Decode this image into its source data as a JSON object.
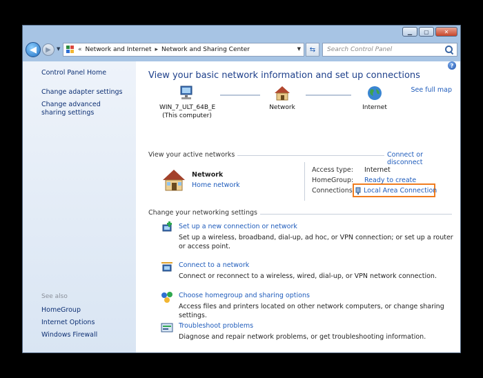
{
  "window": {
    "title_buttons": [
      "minimize",
      "maximize",
      "close"
    ]
  },
  "nav": {
    "breadcrumbs": [
      "Network and Internet",
      "Network and Sharing Center"
    ],
    "separator_left": "«",
    "separator": "▸",
    "search_placeholder": "Search Control Panel"
  },
  "sidebar": {
    "home": "Control Panel Home",
    "links": [
      "Change adapter settings",
      "Change advanced sharing settings"
    ],
    "see_also_label": "See also",
    "see_also": [
      "HomeGroup",
      "Internet Options",
      "Windows Firewall"
    ]
  },
  "main": {
    "title": "View your basic network information and set up connections",
    "see_full_map": "See full map",
    "nodes": [
      {
        "name": "WIN_7_ULT_64B_E",
        "sub": "(This computer)"
      },
      {
        "name": "Network",
        "sub": ""
      },
      {
        "name": "Internet",
        "sub": ""
      }
    ],
    "active_networks": {
      "label": "View your active networks",
      "connect_link": "Connect or disconnect",
      "network_name": "Network",
      "network_type": "Home network",
      "access_type_label": "Access type:",
      "access_type": "Internet",
      "homegroup_label": "HomeGroup:",
      "homegroup": "Ready to create",
      "connections_label": "Connections:",
      "connection": "Local Area Connection"
    },
    "settings": {
      "label": "Change your networking settings",
      "tasks": [
        {
          "title": "Set up a new connection or network",
          "desc": "Set up a wireless, broadband, dial-up, ad hoc, or VPN connection; or set up a router or access point."
        },
        {
          "title": "Connect to a network",
          "desc": "Connect or reconnect to a wireless, wired, dial-up, or VPN network connection."
        },
        {
          "title": "Choose homegroup and sharing options",
          "desc": "Access files and printers located on other network computers, or change sharing settings."
        },
        {
          "title": "Troubleshoot problems",
          "desc": "Diagnose and repair network problems, or get troubleshooting information."
        }
      ]
    }
  },
  "colors": {
    "accent": "#1e5bbb",
    "title": "#1d3f8a",
    "highlight": "#f07c1e"
  }
}
